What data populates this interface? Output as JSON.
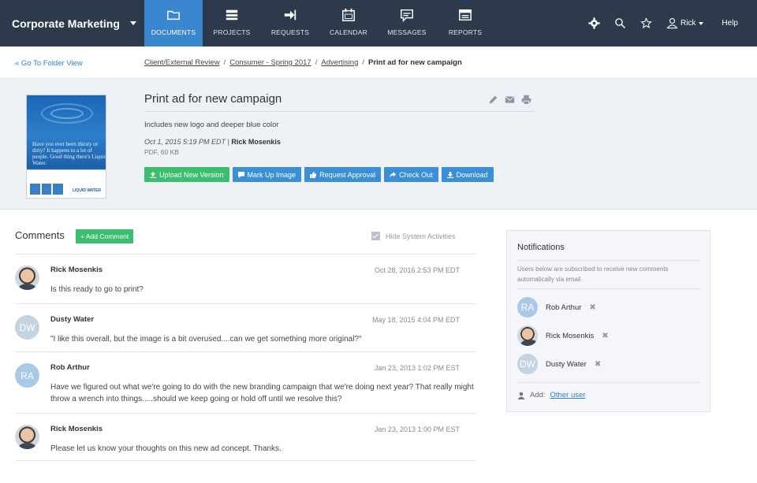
{
  "app": {
    "workspace": "Corporate Marketing"
  },
  "nav": [
    {
      "label": "DOCUMENTS",
      "icon": "folder-icon",
      "active": true
    },
    {
      "label": "PROJECTS",
      "icon": "projects-icon",
      "active": false
    },
    {
      "label": "REQUESTS",
      "icon": "requests-icon",
      "active": false
    },
    {
      "label": "CALENDAR",
      "icon": "calendar-icon",
      "active": false
    },
    {
      "label": "MESSAGES",
      "icon": "messages-icon",
      "active": false
    },
    {
      "label": "REPORTS",
      "icon": "reports-icon",
      "active": false
    }
  ],
  "tools": {
    "user": "Rick",
    "help": "Help"
  },
  "goto_folder": "« Go To Folder View",
  "breadcrumb": [
    "Client/External Review",
    "Consumer - Spring 2017",
    "Advertising",
    "Print ad for new campaign"
  ],
  "document": {
    "title": "Print ad for new campaign",
    "description": "Includes new logo and deeper blue color",
    "date": "Oct 1, 2015 5:19 PM EDT",
    "author": "Rick Mosenkis",
    "file_info": "PDF, 60 KB",
    "thumbnail_text": "Have you ever been thirsty or dirty? It happens to a lot of people. Good thing there's Liquid Water.",
    "thumbnail_brand": "LIQUID WATER"
  },
  "buttons": {
    "upload": "Upload New Version",
    "markup": "Mark Up Image",
    "approval": "Request Approval",
    "checkout": "Check Out",
    "download": "Download"
  },
  "comments_section": {
    "title": "Comments",
    "add_label": "+ Add Comment",
    "hide_label": "Hide System Activities"
  },
  "comments": [
    {
      "name": "Rick Mosenkis",
      "date": "Oct 28, 2016 2:53 PM EDT",
      "text": "Is this ready to go to print?",
      "initials": ""
    },
    {
      "name": "Dusty Water",
      "date": "May 18, 2015 4:04 PM EDT",
      "text": "\"I like this overall, but the image is a bit overused....can we get something more original?\"",
      "initials": "DW"
    },
    {
      "name": "Rob Arthur",
      "date": "Jan 23, 2013 1:02 PM EST",
      "text": "Have we figured out what we're going to do with the new branding campaign that we're doing next year? That really might throw a wrench into things.....should we keep going or hold off until we resolve this?",
      "initials": "RA"
    },
    {
      "name": "Rick Mosenkis",
      "date": "Jan 23, 2013 1:00 PM EST",
      "text": "Please let us know your thoughts on this new ad concept. Thanks.",
      "initials": ""
    }
  ],
  "notifications": {
    "title": "Notifications",
    "description": "Users below are subscribed to receive new comments automatically via email.",
    "subscribers": [
      {
        "name": "Rob Arthur",
        "initials": "RA"
      },
      {
        "name": "Rick Mosenkis",
        "initials": ""
      },
      {
        "name": "Dusty Water",
        "initials": "DW"
      }
    ],
    "remove_symbol": "✖",
    "add_label": "Add:",
    "add_link": "Other user"
  }
}
